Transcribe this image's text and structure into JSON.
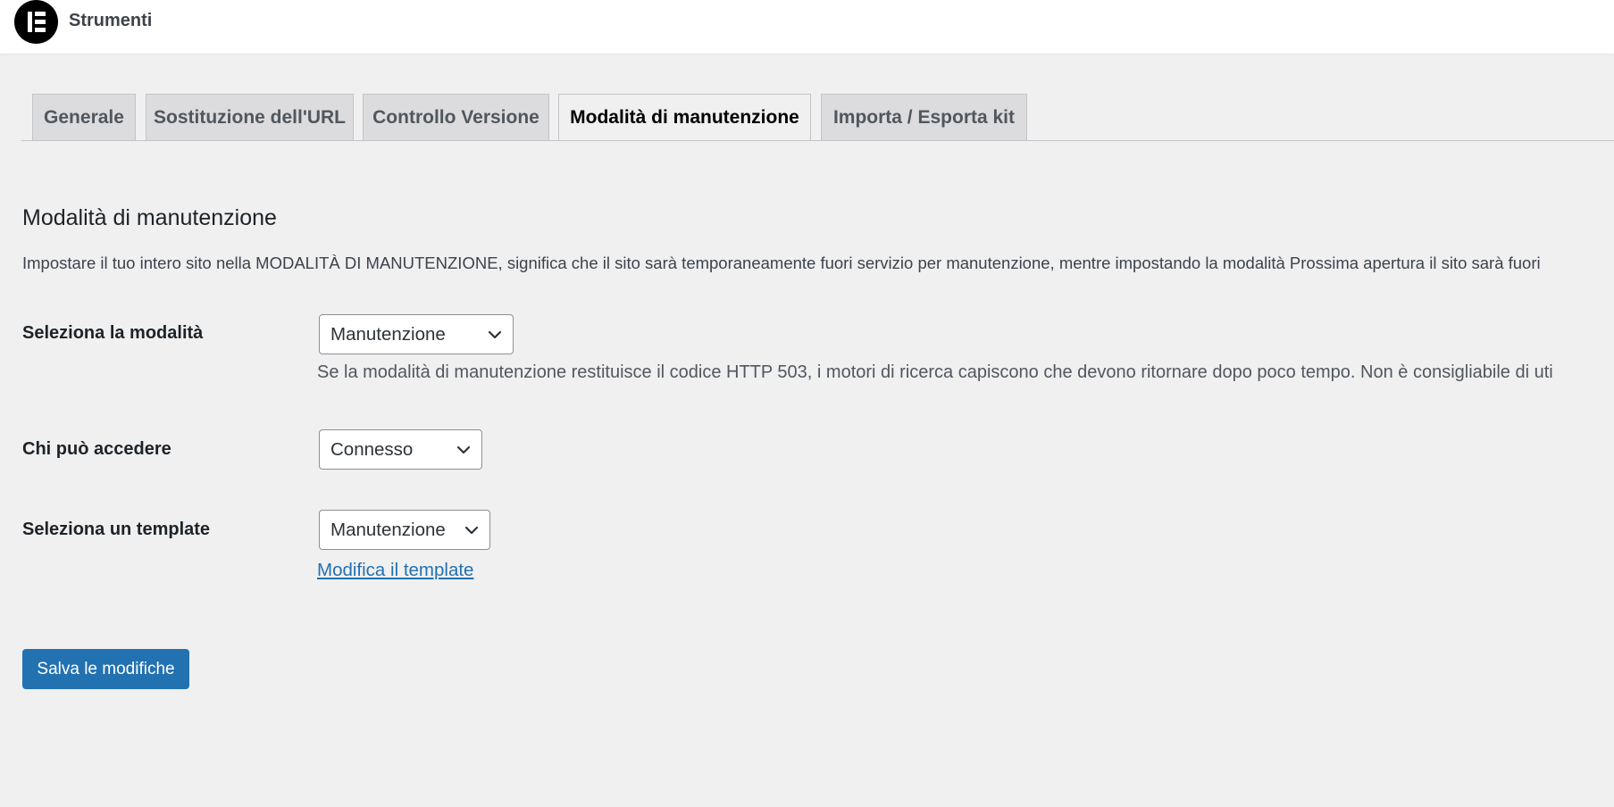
{
  "header": {
    "title": "Strumenti",
    "logo_icon": "elementor-logo-icon"
  },
  "tabs": [
    {
      "label": "Generale",
      "active": false
    },
    {
      "label": "Sostituzione dell'URL",
      "active": false
    },
    {
      "label": "Controllo Versione",
      "active": false
    },
    {
      "label": "Modalità di manutenzione",
      "active": true
    },
    {
      "label": "Importa / Esporta kit",
      "active": false
    }
  ],
  "main": {
    "section_title": "Modalità di manutenzione",
    "description": "Impostare il tuo intero sito nella MODALITÀ DI MANUTENZIONE, significa che il sito sarà temporaneamente fuori servizio per manutenzione, mentre impostando la modalità Prossima apertura il sito sarà fuori",
    "fields": {
      "mode": {
        "label": "Seleziona la modalità",
        "value": "Manutenzione",
        "help": "Se la modalità di manutenzione restituisce il codice HTTP 503, i motori di ricerca capiscono che devono ritornare dopo poco tempo. Non è consigliabile di uti"
      },
      "access": {
        "label": "Chi può accedere",
        "value": "Connesso"
      },
      "template": {
        "label": "Seleziona un template",
        "value": "Manutenzione",
        "edit_link": "Modifica il template"
      }
    },
    "save_button": "Salva le modifiche"
  },
  "colors": {
    "background": "#f0f0f1",
    "accent": "#2271b1",
    "tab_inactive": "#dcdcde"
  }
}
